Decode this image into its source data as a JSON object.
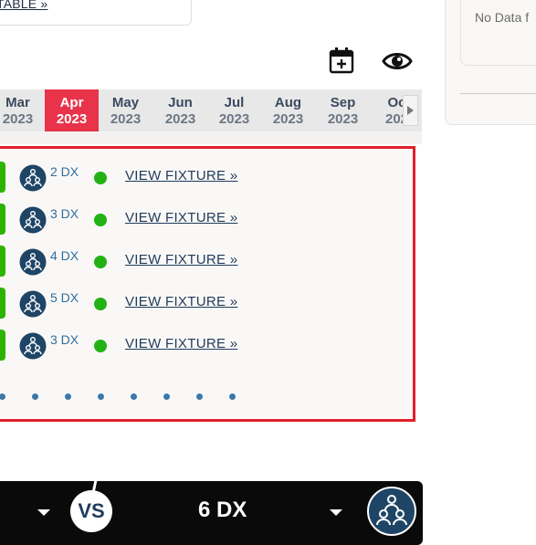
{
  "top_link": "TABLE »",
  "right_panel": {
    "no_data": "No Data f"
  },
  "months": [
    {
      "m": "Mar",
      "y": "2023",
      "active": false
    },
    {
      "m": "Apr",
      "y": "2023",
      "active": true
    },
    {
      "m": "May",
      "y": "2023",
      "active": false
    },
    {
      "m": "Jun",
      "y": "2023",
      "active": false
    },
    {
      "m": "Jul",
      "y": "2023",
      "active": false
    },
    {
      "m": "Aug",
      "y": "2023",
      "active": false
    },
    {
      "m": "Sep",
      "y": "2023",
      "active": false
    },
    {
      "m": "Oc",
      "y": "202",
      "active": false
    }
  ],
  "fixtures": [
    {
      "team": "2 DX",
      "link": "VIEW FIXTURE »"
    },
    {
      "team": "3 DX",
      "link": "VIEW FIXTURE »"
    },
    {
      "team": "4 DX",
      "link": "VIEW FIXTURE »"
    },
    {
      "team": "5 DX",
      "link": "VIEW FIXTURE »"
    },
    {
      "team": "3 DX",
      "link": "VIEW FIXTURE »"
    }
  ],
  "pager_dots": 8,
  "bottom_bar": {
    "vs": "VS",
    "team": "6 DX"
  },
  "colors": {
    "active_month": "#e8334a",
    "status_dot": "#22b214",
    "panel_border": "#e0202c",
    "accent_blue": "#1f3b5a"
  },
  "icons": [
    "calendar-add-icon",
    "eye-icon",
    "team-icon",
    "caret-down-icon",
    "chevron-right-icon"
  ]
}
